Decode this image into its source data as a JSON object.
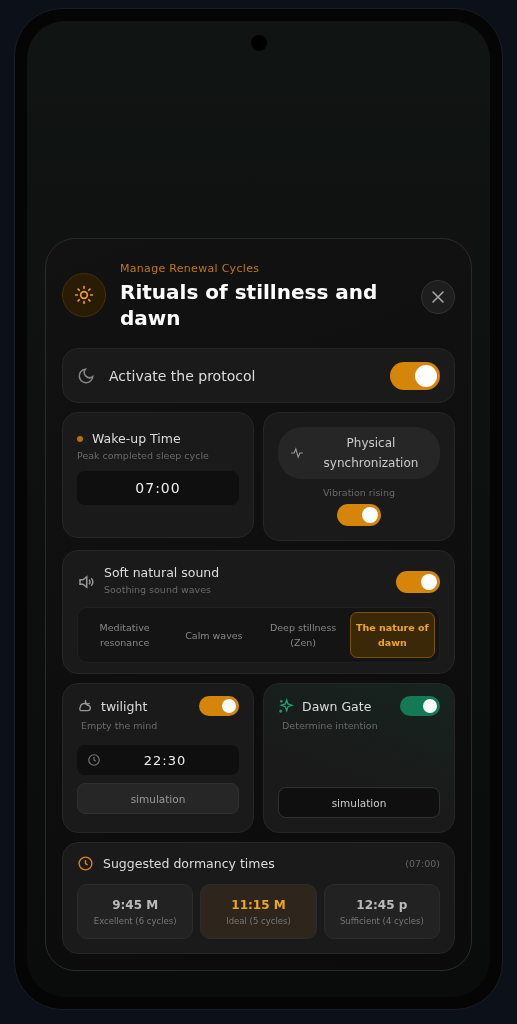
{
  "header": {
    "eyebrow": "Manage Renewal Cycles",
    "title": "Rituals of stillness and dawn"
  },
  "protocol": {
    "label": "Activate the protocol",
    "on": true
  },
  "wake": {
    "title": "Wake-up Time",
    "subtitle": "Peak completed sleep cycle",
    "value": "07:00"
  },
  "sync": {
    "label": "Physical synchronization",
    "subtitle": "Vibration rising",
    "on": true
  },
  "sound": {
    "title": "Soft natural sound",
    "subtitle": "Soothing sound waves",
    "on": true,
    "options": [
      {
        "label": "Meditative resonance",
        "selected": false
      },
      {
        "label": "Calm waves",
        "selected": false
      },
      {
        "label": "Deep stillness (Zen)",
        "selected": false
      },
      {
        "label": "The nature of dawn",
        "selected": true
      }
    ]
  },
  "twilight": {
    "title": "twilight",
    "subtitle": "Empty the mind",
    "on": true,
    "color": "#d4850a",
    "time": "22:30",
    "button": "simulation"
  },
  "dawn_gate": {
    "title": "Dawn Gate",
    "subtitle": "Determine intention",
    "on": true,
    "color": "#137a55",
    "button": "simulation"
  },
  "suggested": {
    "title": "Suggested dormancy times",
    "reference": "(07:00)",
    "items": [
      {
        "time": "9:45 M",
        "note": "Excellent (6 cycles)",
        "selected": false
      },
      {
        "time": "11:15 M",
        "note": "Ideal (5 cycles)",
        "selected": true
      },
      {
        "time": "12:45 p",
        "note": "Sufficient (4 cycles)",
        "selected": false
      }
    ]
  }
}
